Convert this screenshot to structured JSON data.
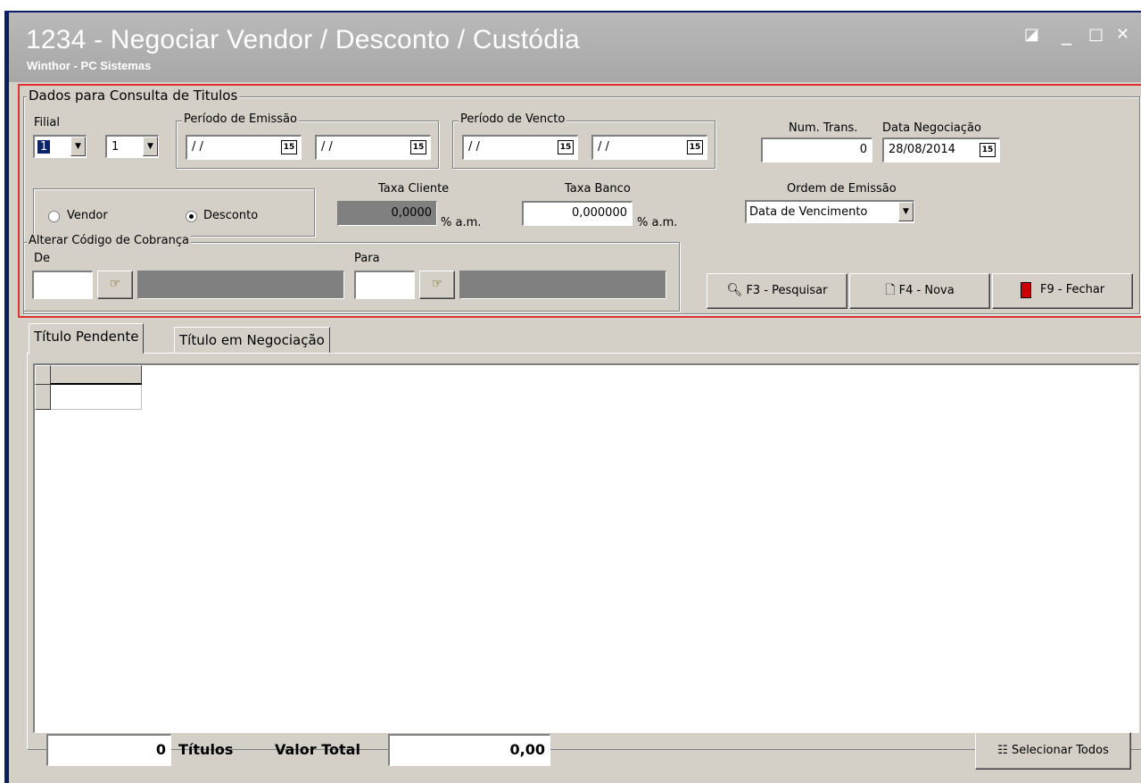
{
  "window": {
    "title": "1234 - Negociar Vendor / Desconto / Custódia",
    "subtitle": "Winthor - PC Sistemas",
    "controls": {
      "restore": "◪",
      "minimize": "_",
      "maximize": "□",
      "close": "✕"
    }
  },
  "filter": {
    "group_title": "Dados para Consulta de Titulos",
    "filial": {
      "label": "Filial",
      "value1": "1",
      "value2": "1"
    },
    "periodo_emissao": {
      "title": "Período de Emissão",
      "from": "/ /",
      "to": "/ /"
    },
    "periodo_vencto": {
      "title": "Período de Vencto",
      "from": "/ /",
      "to": "/ /"
    },
    "num_trans": {
      "label": "Num. Trans.",
      "value": "0"
    },
    "data_negociacao": {
      "label": "Data Negociação",
      "value": "28/08/2014"
    },
    "calendar_icon_text": "15",
    "tipo": {
      "vendor_label": "Vendor",
      "desconto_label": "Desconto",
      "selected": "Desconto"
    },
    "taxa_cliente": {
      "label": "Taxa Cliente",
      "value": "0,0000",
      "unit": "% a.m."
    },
    "taxa_banco": {
      "label": "Taxa Banco",
      "value": "0,000000",
      "unit": "% a.m."
    },
    "ordem_emissao": {
      "label": "Ordem de Emissão",
      "value": "Data de Vencimento"
    },
    "alterar_cobranca": {
      "title": "Alterar Código de Cobrança",
      "de_label": "De",
      "para_label": "Para"
    }
  },
  "actions": {
    "pesquisar": "F3 - Pesquisar",
    "nova": "F4 - Nova",
    "fechar": "F9 - Fechar"
  },
  "tabs": [
    {
      "label": "Título Pendente",
      "active": true
    },
    {
      "label": "Título em Negociação",
      "active": false
    }
  ],
  "footer": {
    "titulos_count": "0",
    "titulos_label": "Títulos",
    "valor_total_label": "Valor Total",
    "valor_total": "0,00",
    "selecionar_todos": "Selecionar Todos"
  },
  "colors": {
    "title_bar": "#a9a9a9",
    "window_bg": "#d4d0c8",
    "highlight_border": "#e03030",
    "frame": "#0d1b6b"
  }
}
